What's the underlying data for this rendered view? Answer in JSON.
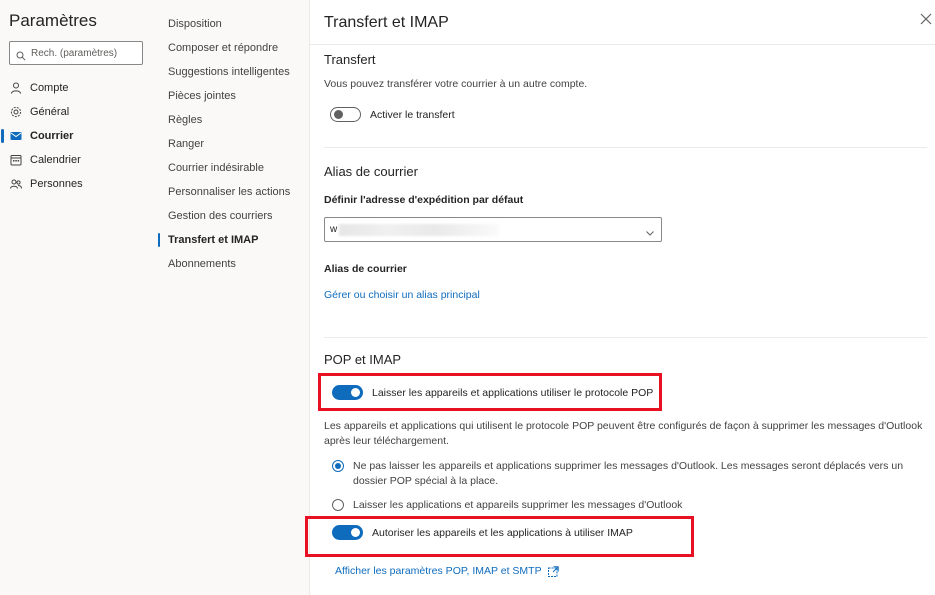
{
  "settings": {
    "title": "Paramètres",
    "search_placeholder": "Rech. (paramètres)"
  },
  "categories": [
    {
      "label": "Compte",
      "icon": "person-icon"
    },
    {
      "label": "Général",
      "icon": "gear-icon"
    },
    {
      "label": "Courrier",
      "icon": "mail-icon",
      "active": true
    },
    {
      "label": "Calendrier",
      "icon": "calendar-icon"
    },
    {
      "label": "Personnes",
      "icon": "people-icon"
    }
  ],
  "subcategories": [
    {
      "label": "Disposition"
    },
    {
      "label": "Composer et répondre"
    },
    {
      "label": "Suggestions intelligentes"
    },
    {
      "label": "Pièces jointes"
    },
    {
      "label": "Règles"
    },
    {
      "label": "Ranger"
    },
    {
      "label": "Courrier indésirable"
    },
    {
      "label": "Personnaliser les actions"
    },
    {
      "label": "Gestion des courriers"
    },
    {
      "label": "Transfert et IMAP",
      "active": true
    },
    {
      "label": "Abonnements"
    }
  ],
  "content": {
    "title": "Transfert et IMAP",
    "forwarding": {
      "title": "Transfert",
      "description": "Vous pouvez transférer votre courrier à un autre compte.",
      "toggle_label": "Activer le transfert",
      "toggle_on": false
    },
    "alias": {
      "title": "Alias de courrier",
      "default_from_label": "Définir l'adresse d'expédition par défaut",
      "default_from_value": "w",
      "alias_label": "Alias de courrier",
      "manage_link": "Gérer ou choisir un alias principal"
    },
    "pop_imap": {
      "title": "POP et IMAP",
      "pop_toggle_label": "Laisser les appareils et applications utiliser le protocole POP",
      "pop_toggle_on": true,
      "pop_description": "Les appareils et applications qui utilisent le protocole POP peuvent être configurés de façon à supprimer les messages d'Outlook après leur téléchargement.",
      "radio_1": "Ne pas laisser les appareils et applications supprimer les messages d'Outlook. Les messages seront déplacés vers un dossier POP spécial à la place.",
      "radio_1_checked": true,
      "radio_2": "Laisser les applications et appareils supprimer les messages d'Outlook",
      "radio_2_checked": false,
      "imap_toggle_label": "Autoriser les appareils et les applications à utiliser IMAP",
      "imap_toggle_on": true,
      "settings_link": "Afficher les paramètres POP, IMAP et SMTP"
    }
  },
  "colors": {
    "accent": "#0f6cbd",
    "highlight": "#e81123"
  }
}
